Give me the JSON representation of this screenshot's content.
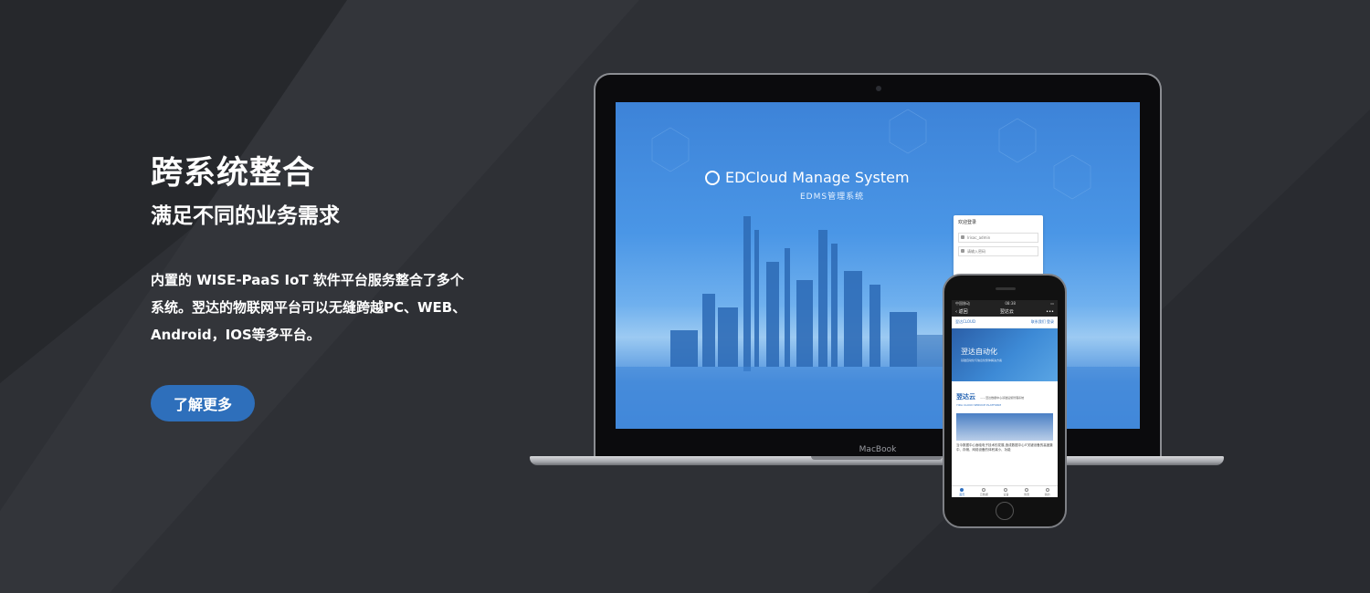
{
  "hero": {
    "title": "跨系统整合",
    "subtitle": "满足不同的业务需求",
    "description": "内置的 WISE-PaaS IoT 软件平台服务整合了多个系统。翌达的物联网平台可以无缝跨越PC、WEB、Android，IOS等多平台。",
    "button_label": "了解更多"
  },
  "laptop": {
    "brand": "MacBook",
    "app_name": "EDCloud Manage System",
    "app_subtitle": "EDMS管理系统",
    "login": {
      "title": "欢迎登录",
      "username_value": "lrisac_admin",
      "password_placeholder": "请输入密码"
    }
  },
  "phone": {
    "status_carrier": "中国移动",
    "status_time": "08:38",
    "nav_back": "返回",
    "nav_title": "翌达云",
    "nav_more": "•••",
    "header_logo": "翌达CLOUD",
    "header_btn1": "联系我们",
    "header_btn2": "登录",
    "banner_title": "翌达自动化",
    "banner_sub": "基础自动化与信息化整体解决方案",
    "section_title": "翌达云",
    "section_sub": "——翌达数据中心基础设施管理系统",
    "section_en": "YIDA CLOUD SERVICE PLATFORM",
    "body_text": "当今数据中心面临电子技术的发展,造成数据中心IT关键设备的高度集中、存储、网络设备的体积减小、功能",
    "tabs": [
      "首页",
      "云数据",
      "设备",
      "告警",
      "我的"
    ]
  },
  "colors": {
    "accent": "#2e6fbb",
    "background": "#2e3035"
  }
}
